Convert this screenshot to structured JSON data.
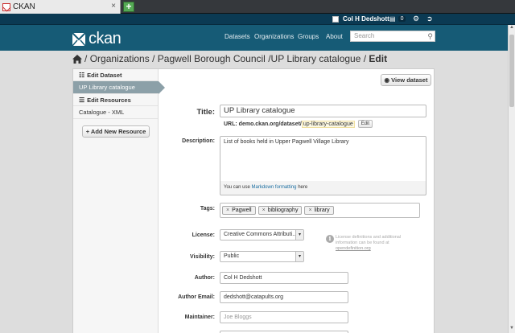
{
  "browser": {
    "tab_title": "CKAN",
    "new_tab_symbol": "+",
    "close_symbol": "×"
  },
  "account": {
    "user_name": "Col H Dedshott",
    "dashboard_count": "0"
  },
  "masthead": {
    "logo_text": "ckan",
    "nav": [
      "Datasets",
      "Organizations",
      "Groups",
      "About"
    ],
    "search_placeholder": "Search"
  },
  "breadcrumb": {
    "sep": "/",
    "organizations": "Organizations",
    "org": "Pagwell Borough Council",
    "dataset": "UP Library catalogue",
    "current": "Edit"
  },
  "sidebar": {
    "edit_dataset_heading": "Edit Dataset",
    "active_item": "UP Library catalogue",
    "edit_resources_heading": "Edit Resources",
    "resource_item": "Catalogue - XML",
    "add_resource_button": "Add New Resource"
  },
  "view_dataset_button": "View dataset",
  "form": {
    "title_label": "Title:",
    "title_value": "UP Library catalogue",
    "url_label": "URL:",
    "url_prefix": "demo.ckan.org/dataset/",
    "url_slug": "up-library-catalogue",
    "url_edit_button": "Edit",
    "description_label": "Description:",
    "description_value": "List of books held in Upper Pagwell Village Library",
    "description_help_pre": "You can use",
    "description_help_link": "Markdown formatting",
    "description_help_post": "here",
    "tags_label": "Tags:",
    "tags": [
      "Pagwell",
      "bibliography",
      "library"
    ],
    "license_label": "License:",
    "license_value": "Creative Commons Attributi...",
    "license_info_text": "License definitions and additional information can be found at",
    "license_info_link": "opendefinition.org",
    "visibility_label": "Visibility:",
    "visibility_value": "Public",
    "author_label": "Author:",
    "author_value": "Col H Dedshott",
    "author_email_label": "Author Email:",
    "author_email_value": "dedshott@catapults.org",
    "maintainer_label": "Maintainer:",
    "maintainer_placeholder": "Joe Bloggs"
  },
  "icons": {
    "home": "home-icon",
    "sitemap": "sitemap-icon",
    "list": "list-icon",
    "plus": "plus-icon",
    "eye": "eye-icon",
    "info": "info-icon",
    "gear": "gear-icon",
    "signout": "signout-icon",
    "dashboard": "dashboard-icon"
  },
  "colors": {
    "masthead": "#165b76",
    "account_bar": "#0b3a53",
    "sidebar_active": "#8ca0a8"
  }
}
